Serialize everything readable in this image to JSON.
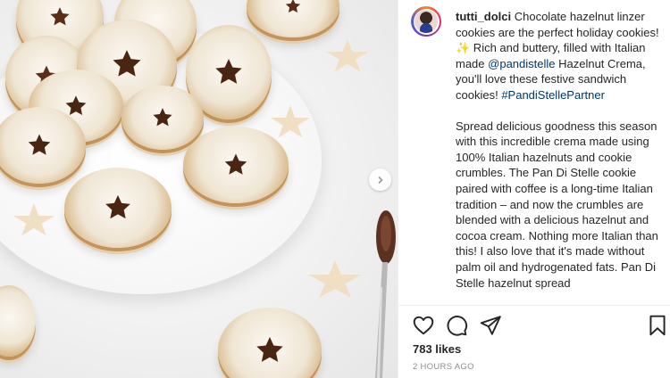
{
  "post": {
    "username": "tutti_dolci",
    "caption_part1": " Chocolate hazelnut linzer cookies are the perfect holiday cookies! ",
    "sparkle": "✨",
    "caption_part2": " Rich and buttery, filled with Italian made ",
    "mention": "@pandistelle",
    "caption_part3": " Hazelnut Crema, you'll love these festive sandwich cookies! ",
    "hashtag": "#PandiStellePartner",
    "paragraph2": "Spread delicious goodness this season with this incredible crema made using 100% Italian hazelnuts and cookie crumbles. The Pan Di Stelle cookie paired with coffee is a long-time Italian tradition – and now the crumbles are blended with a delicious hazelnut and cocoa cream. Nothing more Italian than this! I also love that it's made without palm oil and hydrogenated fats. Pan Di Stelle hazelnut spread"
  },
  "engagement": {
    "likes": "783 likes",
    "timestamp": "2 HOURS AGO"
  },
  "icons": {
    "like": "heart-icon",
    "comment": "comment-bubble-icon",
    "share": "paper-plane-icon",
    "save": "bookmark-icon",
    "next": "chevron-right-icon"
  },
  "colors": {
    "link": "#00376b",
    "text": "#262626",
    "muted": "#8e8e8e",
    "divider": "#efefef"
  }
}
